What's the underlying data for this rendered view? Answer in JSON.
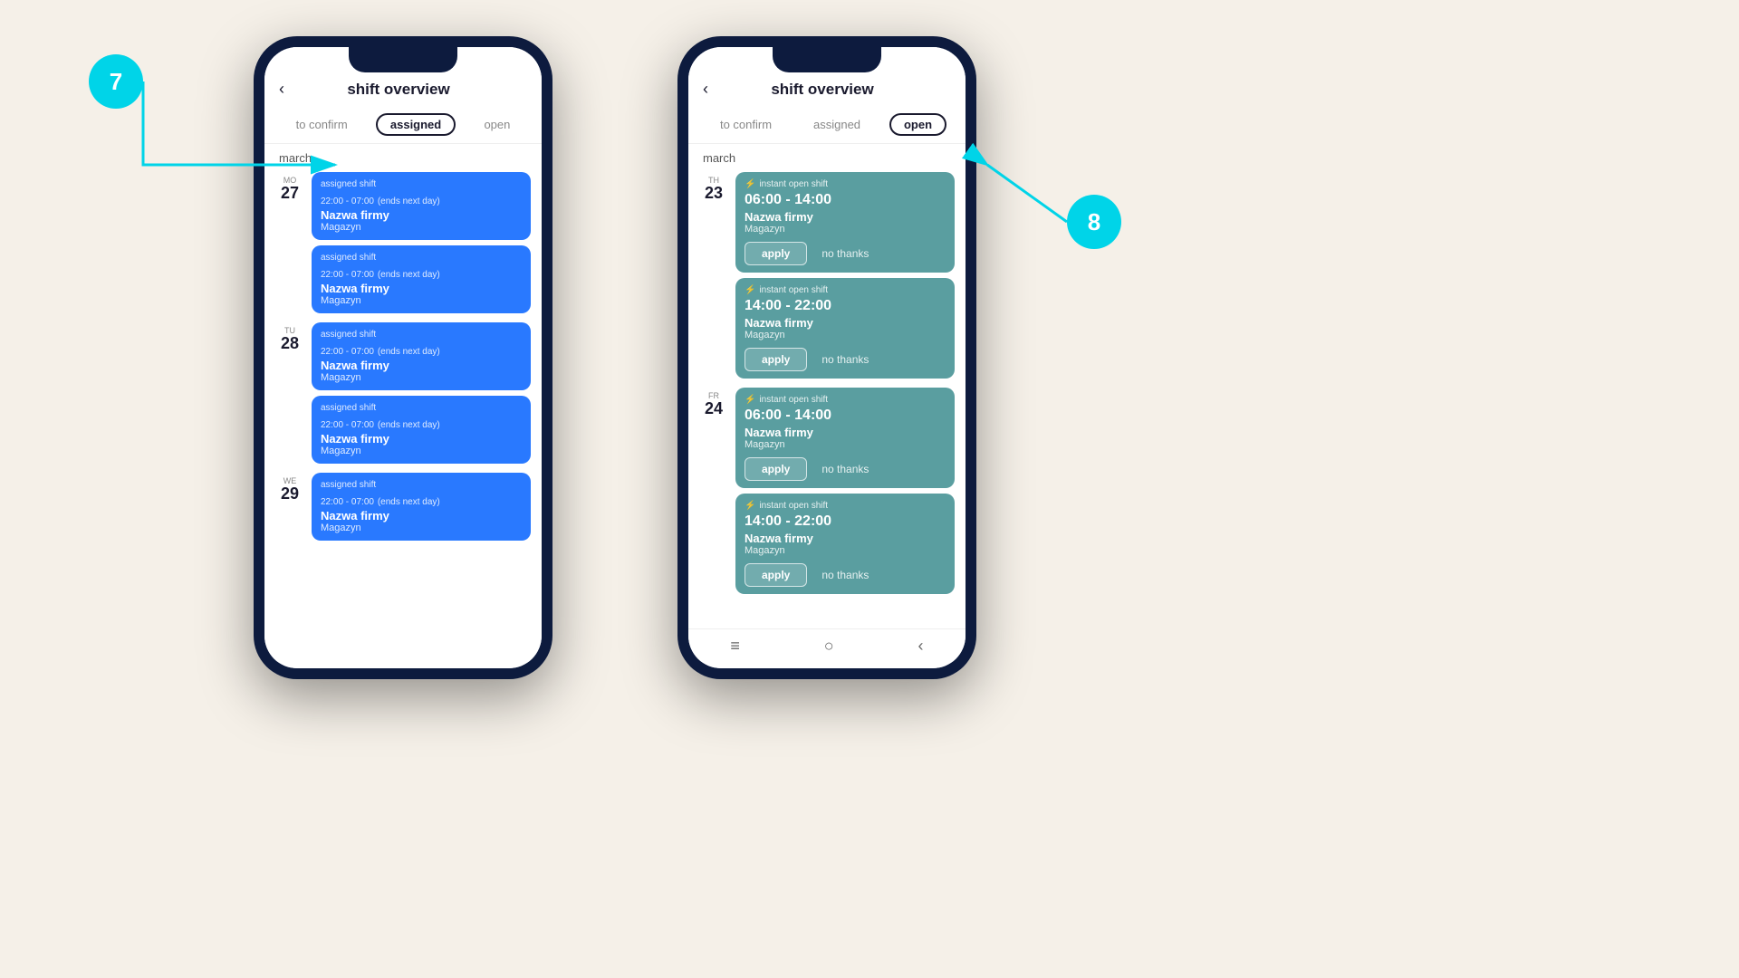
{
  "background": "#f5f0e8",
  "phone1": {
    "title": "shift overview",
    "tabs": [
      "to confirm",
      "assigned",
      "open"
    ],
    "active_tab": "assigned",
    "month": "march",
    "days": [
      {
        "dow": "MO",
        "num": "27",
        "shifts": [
          {
            "label": "assigned shift",
            "time": "22:00 - 07:00",
            "ends_next_day": true,
            "company": "Nazwa firmy",
            "location": "Magazyn"
          },
          {
            "label": "assigned shift",
            "time": "22:00 - 07:00",
            "ends_next_day": true,
            "company": "Nazwa firmy",
            "location": "Magazyn"
          }
        ]
      },
      {
        "dow": "TU",
        "num": "28",
        "shifts": [
          {
            "label": "assigned shift",
            "time": "22:00 - 07:00",
            "ends_next_day": true,
            "company": "Nazwa firmy",
            "location": "Magazyn"
          },
          {
            "label": "assigned shift",
            "time": "22:00 - 07:00",
            "ends_next_day": true,
            "company": "Nazwa firmy",
            "location": "Magazyn"
          }
        ]
      },
      {
        "dow": "WE",
        "num": "29",
        "shifts": [
          {
            "label": "assigned shift",
            "time": "22:00 - 07:00",
            "ends_next_day": true,
            "company": "Nazwa firmy",
            "location": "Magazyn"
          }
        ]
      }
    ]
  },
  "phone2": {
    "title": "shift overview",
    "tabs": [
      "to confirm",
      "assigned",
      "open"
    ],
    "active_tab": "open",
    "month": "march",
    "days": [
      {
        "dow": "TH",
        "num": "23",
        "shifts": [
          {
            "label": "instant open shift",
            "time": "06:00 - 14:00",
            "company": "Nazwa firmy",
            "location": "Magazyn"
          },
          {
            "label": "instant open shift",
            "time": "14:00 - 22:00",
            "company": "Nazwa firmy",
            "location": "Magazyn"
          }
        ]
      },
      {
        "dow": "FR",
        "num": "24",
        "shifts": [
          {
            "label": "instant open shift",
            "time": "06:00 - 14:00",
            "company": "Nazwa firmy",
            "location": "Magazyn"
          },
          {
            "label": "instant open shift",
            "time": "14:00 - 22:00",
            "company": "Nazwa firmy",
            "location": "Magazyn"
          }
        ]
      }
    ]
  },
  "annotations": {
    "bubble7": "7",
    "bubble8": "8"
  },
  "buttons": {
    "apply": "apply",
    "no_thanks": "no thanks"
  }
}
